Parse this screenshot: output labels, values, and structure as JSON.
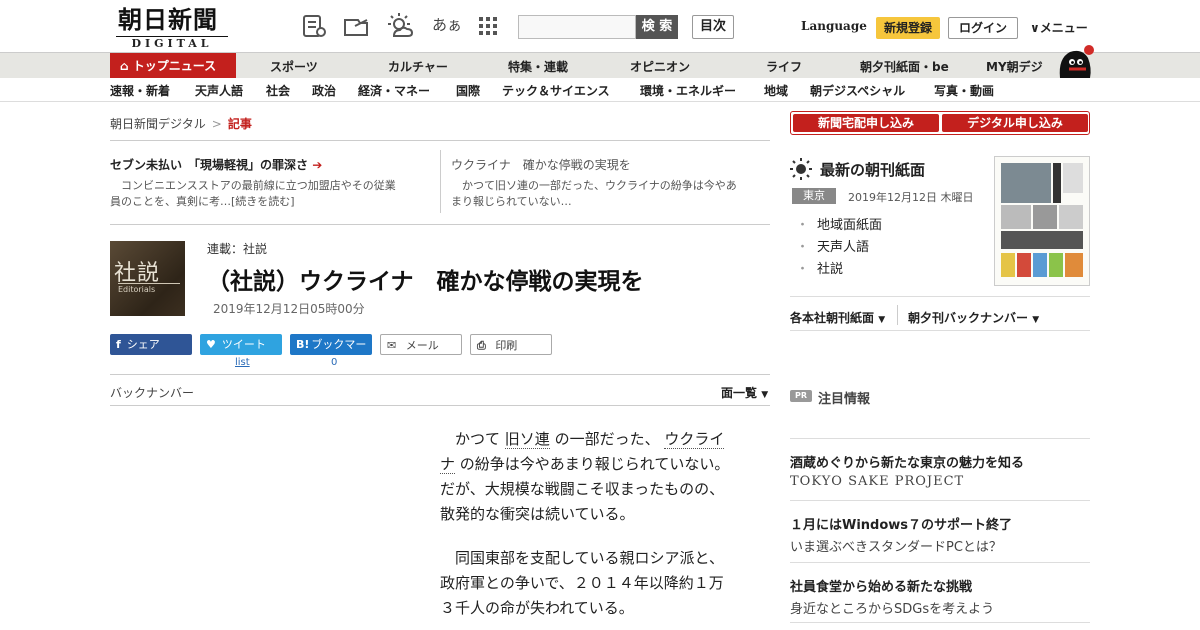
{
  "header": {
    "logo_ja": "朝日新聞",
    "logo_en": "DIGITAL",
    "search_label": "検 索",
    "search_placeholder": "",
    "index_label": "目次",
    "language_label": "Language",
    "register_label": "新規登録",
    "login_label": "ログイン",
    "menu_label": "メニュー",
    "font_size_label": "あぁ"
  },
  "nav_primary": {
    "active": "トップニュース",
    "items": [
      "スポーツ",
      "カルチャー",
      "特集・連載",
      "オピニオン",
      "ライフ",
      "朝夕刊紙面・be",
      "MY朝デジ"
    ]
  },
  "nav_secondary": {
    "items": [
      "速報・新着",
      "天声人語",
      "社会",
      "政治",
      "経済・マネー",
      "国際",
      "テック＆サイエンス",
      "環境・エネルギー",
      "地域",
      "朝デジスペシャル",
      "写真・動画"
    ]
  },
  "breadcrumb": {
    "home": "朝日新聞デジタル",
    "separator": ">",
    "current": "記事"
  },
  "picks": [
    {
      "title": "セブン未払い　「現場軽視」の罪深さ",
      "arrow": "➔",
      "body_line1": "　コンビニエンスストアの最前線に立つ加盟店やその従業",
      "body_line2": "員のことを、真剣に考…[続きを読む]"
    },
    {
      "title": "ウクライナ　確かな停戦の実現を",
      "body_line1": "　かつて旧ソ連の一部だった、ウクライナの紛争は今やあ",
      "body_line2": "まり報じられていない…"
    }
  ],
  "article": {
    "thumb_ja": "社説",
    "thumb_en": "Editorials",
    "series": "連載：社説",
    "headline": "（社説）ウクライナ　確かな停戦の実現を",
    "date": "2019年12月12日05時00分",
    "paragraphs": [
      {
        "line1_a": "　かつて ",
        "kw1": "旧ソ連",
        "line1_b": " の一部だった、 ",
        "kw2a": "ウクライ",
        "kw2b": "ナ",
        "line2": " の紛争は今やあまり報じられていない。",
        "line3": "だが、大規模な戦闘こそ収まったものの、",
        "line4": "散発的な衝突は続いている。"
      },
      {
        "line1": "　同国東部を支配している親ロシア派と、",
        "line2": "政府軍との争いで、２０１４年以降約１万",
        "line3": "３千人の命が失われている。"
      }
    ]
  },
  "share": {
    "facebook": "シェア",
    "twitter": "ツイート",
    "hatena": "ブックマーク",
    "hatena_icon": "B!",
    "mail": "メール",
    "print": "印刷",
    "twitter_count": "list",
    "hatena_count": "0"
  },
  "backnumber": {
    "label": "バックナンバー",
    "toggle": "面一覧",
    "toggle_arrow": "▼"
  },
  "sidebar": {
    "subscribe_paper": "新聞宅配申し込み",
    "subscribe_digital": "デジタル申し込み",
    "paper_title": "最新の朝刊紙面",
    "region": "東京",
    "paper_date": "2019年12月12日 木曜日",
    "paper_links": [
      "地域面紙面",
      "天声人語",
      "社説"
    ],
    "dropdowns": [
      "各本社朝刊紙面",
      "朝夕刊バックナンバー"
    ],
    "dropdown_arrow": "▼",
    "pr_badge": "PR",
    "pr_title": "注目情報",
    "pr_items": [
      {
        "title": "酒蔵めぐりから新たな東京の魅力を知る",
        "sub": "TOKYO SAKE PROJECT"
      },
      {
        "title": "１月にはWindows７のサポート終了",
        "sub": "いま選ぶべきスタンダードPCとは？"
      },
      {
        "title": "社員食堂から始める新たな挑戦",
        "sub": "身近なところからSDGsを考えよう"
      }
    ]
  },
  "colors": {
    "brand_red": "#c3201d",
    "register_yellow": "#f6c63c",
    "facebook": "#2f5596",
    "twitter": "#2fa3e0",
    "hatena": "#1e77c7"
  }
}
